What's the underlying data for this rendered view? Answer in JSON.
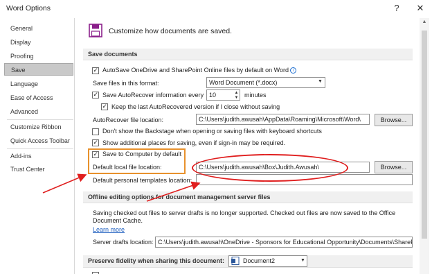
{
  "window": {
    "title": "Word Options",
    "help": "?",
    "close": "✕"
  },
  "sidebar": {
    "items": [
      {
        "label": "General"
      },
      {
        "label": "Display"
      },
      {
        "label": "Proofing"
      },
      {
        "label": "Save",
        "selected": true
      },
      {
        "label": "Language"
      },
      {
        "label": "Ease of Access"
      },
      {
        "label": "Advanced"
      },
      {
        "label": "Customize Ribbon"
      },
      {
        "label": "Quick Access Toolbar"
      },
      {
        "label": "Add-ins"
      },
      {
        "label": "Trust Center"
      }
    ]
  },
  "header": {
    "text": "Customize how documents are saved.",
    "icon": "save-disk-icon"
  },
  "save_documents": {
    "title": "Save documents",
    "autosave_label": "AutoSave OneDrive and SharePoint Online files by default on Word",
    "autosave_checked": true,
    "info_glyph": "i",
    "format_label": "Save files in this format:",
    "format_value": "Word Document (*.docx)",
    "autorecover_label": "Save AutoRecover information every",
    "autorecover_checked": true,
    "autorecover_value": "10",
    "minutes_label": "minutes",
    "keep_label": "Keep the last AutoRecovered version if I close without saving",
    "keep_checked": true,
    "ar_location_label": "AutoRecover file location:",
    "ar_location_value": "C:\\Users\\judith.awusah\\AppData\\Roaming\\Microsoft\\Word\\",
    "browse_label": "Browse...",
    "backstage_label": "Don't show the Backstage when opening or saving files with keyboard shortcuts",
    "backstage_checked": false,
    "additional_label": "Show additional places for saving, even if sign-in may be required.",
    "additional_checked": true,
    "save_computer_label": "Save to Computer by default",
    "save_computer_checked": true,
    "default_local_label": "Default local file location:",
    "default_local_value": "C:\\Users\\judith.awusah\\Box\\Judith.Awusah\\",
    "browse2_label": "Browse...",
    "personal_templates_label": "Default personal templates location:",
    "personal_templates_value": ""
  },
  "offline": {
    "title": "Offline editing options for document management server files",
    "note": "Saving checked out files to server drafts is no longer supported. Checked out files are now saved to the Office Document Cache.",
    "learn_more": "Learn more",
    "drafts_label": "Server drafts location:",
    "drafts_value": "C:\\Users\\judith.awusah\\OneDrive - Sponsors for Educational Opportunity\\Documents\\SharePoint Drafts\\"
  },
  "fidelity": {
    "title": "Preserve fidelity when sharing this document:",
    "document_value": "Document2"
  },
  "colors": {
    "annotation_orange": "#e8912c",
    "annotation_red": "#e01f1f",
    "link_blue": "#1f5fbf"
  }
}
